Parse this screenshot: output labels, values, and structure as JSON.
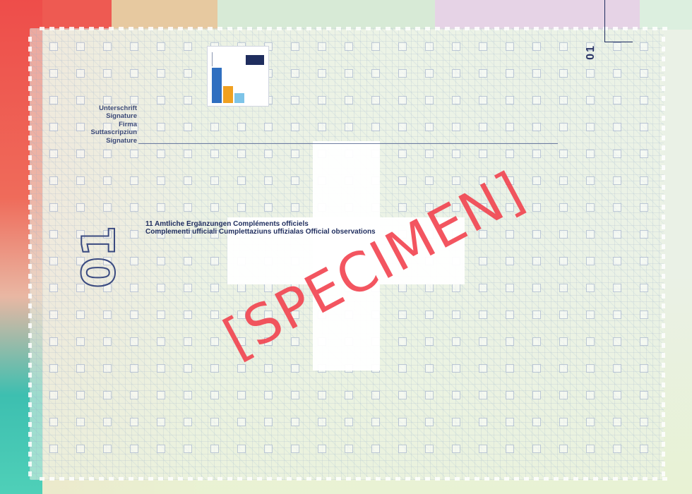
{
  "document": {
    "signature_labels": [
      "Unterschrift",
      "Signature",
      "Firma",
      "Suttascripziun",
      "Signature"
    ],
    "observations": {
      "line1": "11 Amtliche Ergänzungen Compléments officiels",
      "line2": "Complementi ufficiali Cumplettaziuns uffizialas Official observations"
    },
    "page_number_small": "01",
    "page_number_large": "01",
    "watermark": "[SPECIMEN]"
  },
  "colors": {
    "specimen_red": "#f2434f",
    "ink_blue": "#1f2d5e",
    "edge_red": "#ee4d4a",
    "edge_teal": "#3dbfb0"
  }
}
